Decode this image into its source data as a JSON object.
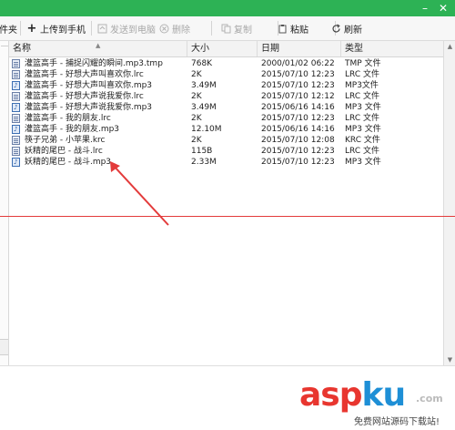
{
  "window": {
    "min_label": "–",
    "close_label": "✕"
  },
  "toolbar": {
    "clipped_label": "件夹",
    "upload": {
      "icon": "plus-icon",
      "label": "上传到手机"
    },
    "send": {
      "icon": "send-icon",
      "label": "发送到电脑"
    },
    "delete": {
      "icon": "delete-icon",
      "label": "删除"
    },
    "copy": {
      "icon": "copy-icon",
      "label": "复制"
    },
    "paste": {
      "icon": "paste-icon",
      "label": "粘贴"
    },
    "refresh": {
      "icon": "refresh-icon",
      "label": "刷新"
    }
  },
  "table": {
    "columns": [
      "名称",
      "大小",
      "日期",
      "类型"
    ],
    "rows": [
      {
        "name": "灌篮高手 - 捕捉闪耀的瞬间.mp3.tmp",
        "size": "768K",
        "date": "2000/01/02 06:22",
        "type": "TMP 文件",
        "icon": "document-icon"
      },
      {
        "name": "灌篮高手 - 好想大声叫喜欢你.lrc",
        "size": "2K",
        "date": "2015/07/10 12:23",
        "type": "LRC 文件",
        "icon": "document-icon"
      },
      {
        "name": "灌篮高手 - 好想大声叫喜欢你.mp3",
        "size": "3.49M",
        "date": "2015/07/10 12:23",
        "type": "MP3文件",
        "icon": "music-file-icon"
      },
      {
        "name": "灌篮高手 - 好想大声说我爱你.lrc",
        "size": "2K",
        "date": "2015/07/10 12:12",
        "type": "LRC 文件",
        "icon": "document-icon"
      },
      {
        "name": "灌篮高手 - 好想大声说我爱你.mp3",
        "size": "3.49M",
        "date": "2015/06/16 14:16",
        "type": "MP3 文件",
        "icon": "music-file-icon"
      },
      {
        "name": "灌篮高手 - 我的朋友.lrc",
        "size": "2K",
        "date": "2015/07/10 12:23",
        "type": "LRC 文件",
        "icon": "document-icon"
      },
      {
        "name": "灌篮高手 - 我的朋友.mp3",
        "size": "12.10M",
        "date": "2015/06/16 14:16",
        "type": "MP3 文件",
        "icon": "music-file-icon"
      },
      {
        "name": "筷子兄弟 - 小苹果.krc",
        "size": "2K",
        "date": "2015/07/10 12:08",
        "type": "KRC 文件",
        "icon": "document-icon"
      },
      {
        "name": "妖精的尾巴 - 战斗.lrc",
        "size": "115B",
        "date": "2015/07/10 12:23",
        "type": "LRC 文件",
        "icon": "document-icon"
      },
      {
        "name": "妖精的尾巴 - 战斗.mp3",
        "size": "2.33M",
        "date": "2015/07/10 12:23",
        "type": "MP3 文件",
        "icon": "music-file-icon"
      }
    ]
  },
  "watermark": {
    "logo_asp": "asp",
    "logo_ku": "ku",
    "logo_com": ".com",
    "subtitle": "免费网站源码下载站!"
  },
  "colors": {
    "titlebar": "#2db255",
    "annotation": "#e33b3b"
  }
}
